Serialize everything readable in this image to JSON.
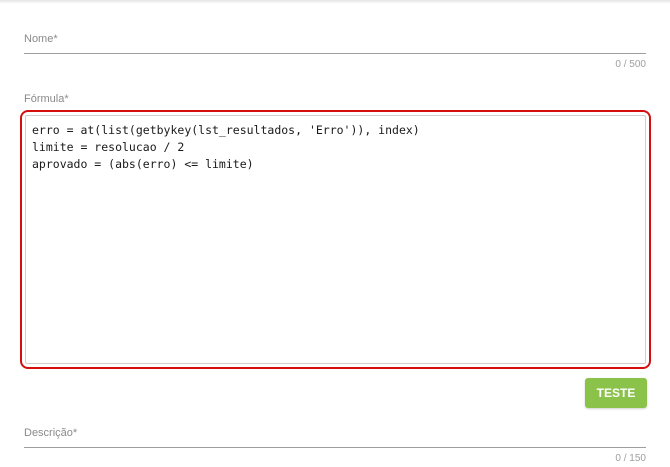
{
  "form": {
    "nome": {
      "label": "Nome*",
      "value": "",
      "counter": "0 / 500"
    },
    "formula": {
      "label": "Fórmula*",
      "lines": [
        "erro = at(list(getbykey(lst_resultados, 'Erro')), index)",
        "limite = resolucao / 2",
        "aprovado = (abs(erro) <= limite)"
      ]
    },
    "test_button_label": "TESTE",
    "descricao": {
      "label": "Descrição*",
      "value": "",
      "counter": "0 / 150"
    }
  },
  "colors": {
    "highlight_border": "#d3100f",
    "button_green": "#8bc34a",
    "label_gray": "#8a8a8a"
  }
}
